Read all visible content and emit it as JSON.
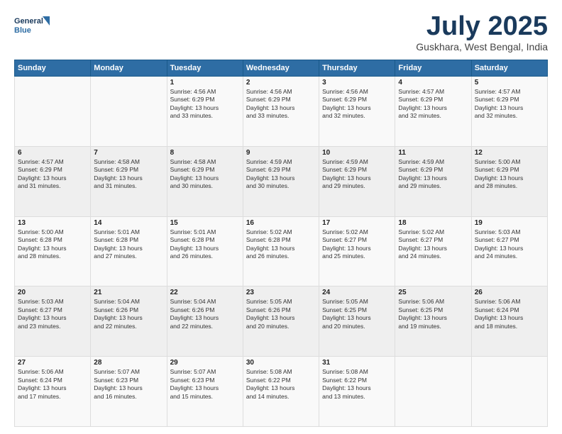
{
  "header": {
    "logo_line1": "General",
    "logo_line2": "Blue",
    "month_year": "July 2025",
    "location": "Guskhara, West Bengal, India"
  },
  "weekdays": [
    "Sunday",
    "Monday",
    "Tuesday",
    "Wednesday",
    "Thursday",
    "Friday",
    "Saturday"
  ],
  "weeks": [
    [
      {
        "day": "",
        "info": ""
      },
      {
        "day": "",
        "info": ""
      },
      {
        "day": "1",
        "info": "Sunrise: 4:56 AM\nSunset: 6:29 PM\nDaylight: 13 hours\nand 33 minutes."
      },
      {
        "day": "2",
        "info": "Sunrise: 4:56 AM\nSunset: 6:29 PM\nDaylight: 13 hours\nand 33 minutes."
      },
      {
        "day": "3",
        "info": "Sunrise: 4:56 AM\nSunset: 6:29 PM\nDaylight: 13 hours\nand 32 minutes."
      },
      {
        "day": "4",
        "info": "Sunrise: 4:57 AM\nSunset: 6:29 PM\nDaylight: 13 hours\nand 32 minutes."
      },
      {
        "day": "5",
        "info": "Sunrise: 4:57 AM\nSunset: 6:29 PM\nDaylight: 13 hours\nand 32 minutes."
      }
    ],
    [
      {
        "day": "6",
        "info": "Sunrise: 4:57 AM\nSunset: 6:29 PM\nDaylight: 13 hours\nand 31 minutes."
      },
      {
        "day": "7",
        "info": "Sunrise: 4:58 AM\nSunset: 6:29 PM\nDaylight: 13 hours\nand 31 minutes."
      },
      {
        "day": "8",
        "info": "Sunrise: 4:58 AM\nSunset: 6:29 PM\nDaylight: 13 hours\nand 30 minutes."
      },
      {
        "day": "9",
        "info": "Sunrise: 4:59 AM\nSunset: 6:29 PM\nDaylight: 13 hours\nand 30 minutes."
      },
      {
        "day": "10",
        "info": "Sunrise: 4:59 AM\nSunset: 6:29 PM\nDaylight: 13 hours\nand 29 minutes."
      },
      {
        "day": "11",
        "info": "Sunrise: 4:59 AM\nSunset: 6:29 PM\nDaylight: 13 hours\nand 29 minutes."
      },
      {
        "day": "12",
        "info": "Sunrise: 5:00 AM\nSunset: 6:29 PM\nDaylight: 13 hours\nand 28 minutes."
      }
    ],
    [
      {
        "day": "13",
        "info": "Sunrise: 5:00 AM\nSunset: 6:28 PM\nDaylight: 13 hours\nand 28 minutes."
      },
      {
        "day": "14",
        "info": "Sunrise: 5:01 AM\nSunset: 6:28 PM\nDaylight: 13 hours\nand 27 minutes."
      },
      {
        "day": "15",
        "info": "Sunrise: 5:01 AM\nSunset: 6:28 PM\nDaylight: 13 hours\nand 26 minutes."
      },
      {
        "day": "16",
        "info": "Sunrise: 5:02 AM\nSunset: 6:28 PM\nDaylight: 13 hours\nand 26 minutes."
      },
      {
        "day": "17",
        "info": "Sunrise: 5:02 AM\nSunset: 6:27 PM\nDaylight: 13 hours\nand 25 minutes."
      },
      {
        "day": "18",
        "info": "Sunrise: 5:02 AM\nSunset: 6:27 PM\nDaylight: 13 hours\nand 24 minutes."
      },
      {
        "day": "19",
        "info": "Sunrise: 5:03 AM\nSunset: 6:27 PM\nDaylight: 13 hours\nand 24 minutes."
      }
    ],
    [
      {
        "day": "20",
        "info": "Sunrise: 5:03 AM\nSunset: 6:27 PM\nDaylight: 13 hours\nand 23 minutes."
      },
      {
        "day": "21",
        "info": "Sunrise: 5:04 AM\nSunset: 6:26 PM\nDaylight: 13 hours\nand 22 minutes."
      },
      {
        "day": "22",
        "info": "Sunrise: 5:04 AM\nSunset: 6:26 PM\nDaylight: 13 hours\nand 22 minutes."
      },
      {
        "day": "23",
        "info": "Sunrise: 5:05 AM\nSunset: 6:26 PM\nDaylight: 13 hours\nand 20 minutes."
      },
      {
        "day": "24",
        "info": "Sunrise: 5:05 AM\nSunset: 6:25 PM\nDaylight: 13 hours\nand 20 minutes."
      },
      {
        "day": "25",
        "info": "Sunrise: 5:06 AM\nSunset: 6:25 PM\nDaylight: 13 hours\nand 19 minutes."
      },
      {
        "day": "26",
        "info": "Sunrise: 5:06 AM\nSunset: 6:24 PM\nDaylight: 13 hours\nand 18 minutes."
      }
    ],
    [
      {
        "day": "27",
        "info": "Sunrise: 5:06 AM\nSunset: 6:24 PM\nDaylight: 13 hours\nand 17 minutes."
      },
      {
        "day": "28",
        "info": "Sunrise: 5:07 AM\nSunset: 6:23 PM\nDaylight: 13 hours\nand 16 minutes."
      },
      {
        "day": "29",
        "info": "Sunrise: 5:07 AM\nSunset: 6:23 PM\nDaylight: 13 hours\nand 15 minutes."
      },
      {
        "day": "30",
        "info": "Sunrise: 5:08 AM\nSunset: 6:22 PM\nDaylight: 13 hours\nand 14 minutes."
      },
      {
        "day": "31",
        "info": "Sunrise: 5:08 AM\nSunset: 6:22 PM\nDaylight: 13 hours\nand 13 minutes."
      },
      {
        "day": "",
        "info": ""
      },
      {
        "day": "",
        "info": ""
      }
    ]
  ]
}
